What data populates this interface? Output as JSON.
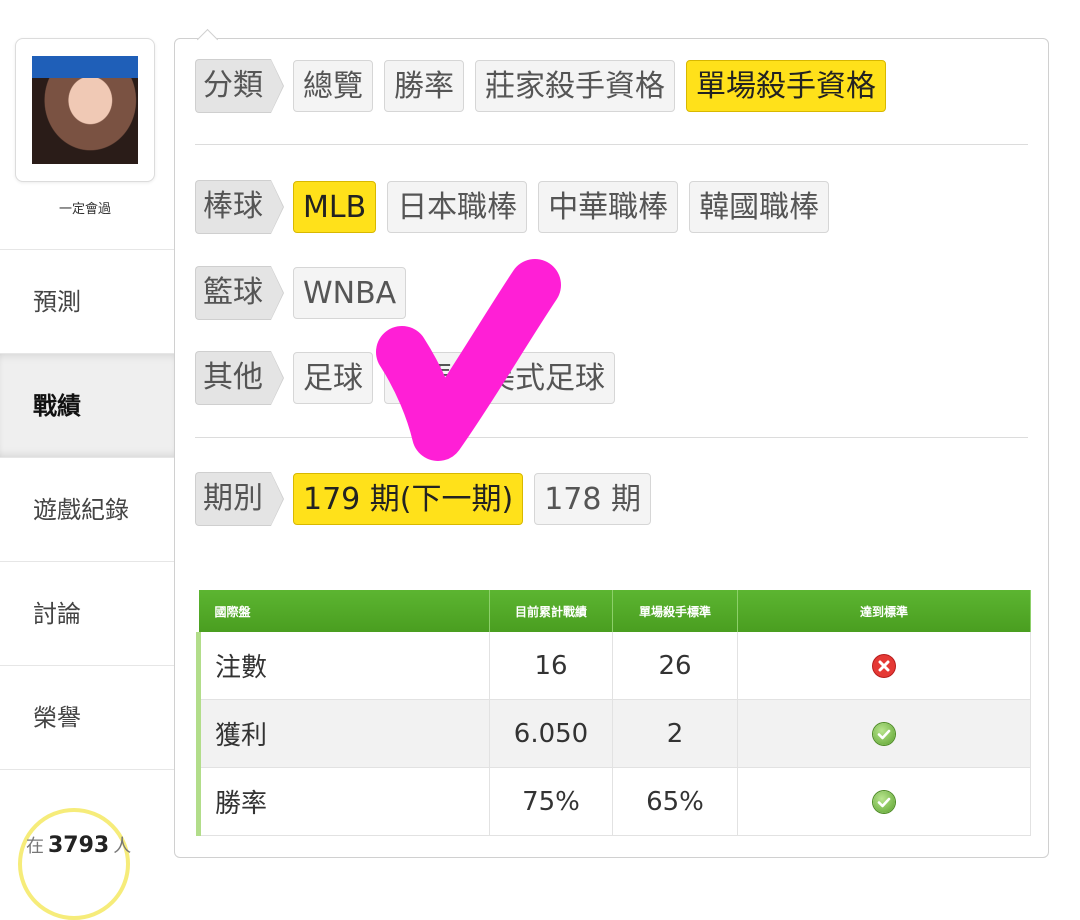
{
  "user": {
    "name": "一定會過"
  },
  "sidebar": {
    "items": [
      {
        "label": "預測",
        "active": false
      },
      {
        "label": "戰績",
        "active": true
      },
      {
        "label": "遊戲紀錄",
        "active": false
      },
      {
        "label": "討論",
        "active": false
      },
      {
        "label": "榮譽",
        "active": false
      }
    ],
    "badge": {
      "value": "3793"
    }
  },
  "filters": {
    "category": {
      "label": "分類",
      "options": [
        "總覽",
        "勝率",
        "莊家殺手資格",
        "單場殺手資格"
      ],
      "selected": "單場殺手資格"
    },
    "baseball": {
      "label": "棒球",
      "options": [
        "MLB",
        "日本職棒",
        "中華職棒",
        "韓國職棒"
      ],
      "selected": "MLB"
    },
    "basketball": {
      "label": "籃球",
      "options": [
        "WNBA"
      ]
    },
    "other": {
      "label": "其他",
      "options": [
        "足球",
        "賽馬",
        "美式足球"
      ]
    },
    "period": {
      "label": "期別",
      "options": [
        "179 期(下一期)",
        "178 期"
      ],
      "selected": "179 期(下一期)"
    }
  },
  "table": {
    "headers": [
      "國際盤",
      "目前累計戰績",
      "單場殺手標準",
      "達到標準"
    ],
    "rows": [
      {
        "name": "注數",
        "current": "16",
        "standard": "26",
        "met": false
      },
      {
        "name": "獲利",
        "current": "6.050",
        "standard": "2",
        "met": true
      },
      {
        "name": "勝率",
        "current": "75%",
        "standard": "65%",
        "met": true
      }
    ]
  },
  "colors": {
    "selected": "#ffe11a",
    "table_header": "#4fa426",
    "annotation": "#ff1fd6"
  },
  "icons": {
    "fail": "x-circle-icon",
    "pass": "check-circle-icon"
  }
}
